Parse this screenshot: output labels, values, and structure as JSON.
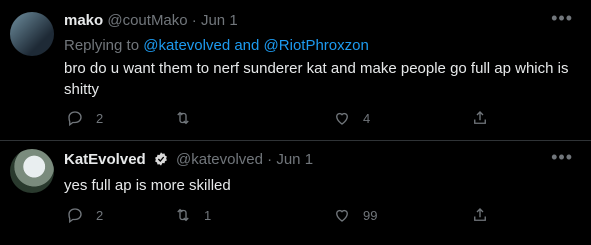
{
  "tweets": [
    {
      "name": "mako",
      "handle": "@coutMako",
      "date": "Jun 1",
      "replying_prefix": "Replying to",
      "replying_to": "@katevolved",
      "replying_join": "and",
      "replying_to_2": "@RiotPhroxzon",
      "text": "bro do u want them to nerf sunderer kat and make people go full ap which is shitty",
      "replies": "2",
      "retweets": "",
      "likes": "4"
    },
    {
      "name": "KatEvolved",
      "handle": "@katevolved",
      "date": "Jun 1",
      "verified": true,
      "text": "yes full ap is more skilled",
      "replies": "2",
      "retweets": "1",
      "likes": "99"
    }
  ],
  "separator": "·",
  "more_icon": "more-horizontal-icon",
  "colors": {
    "background": "#000000",
    "text": "#e7e9ea",
    "muted": "#71767b",
    "link": "#1d9bf0",
    "verified": "#d9d9d9"
  }
}
